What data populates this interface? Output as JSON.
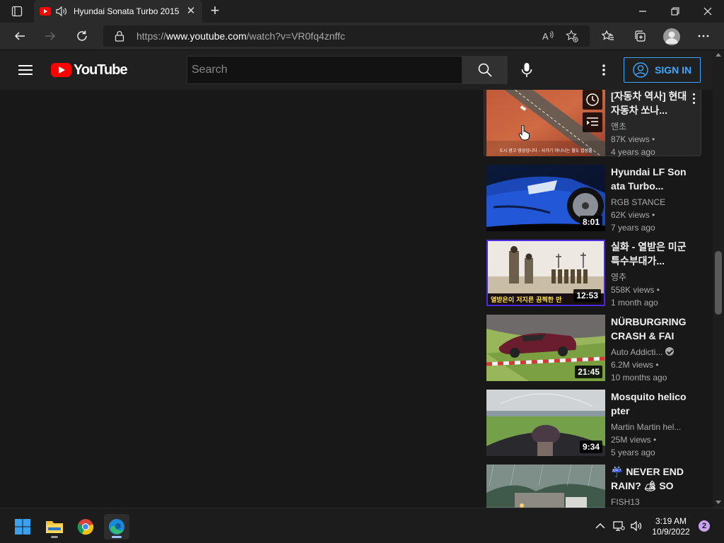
{
  "browser": {
    "tab_title": "Hyundai Sonata Turbo 2015",
    "tab_close": "✕",
    "new_tab": "+",
    "url_prefix": "https://",
    "url_domain": "www.youtube.com",
    "url_path": "/watch?v=VR0fq4znffc"
  },
  "youtube": {
    "logo_text": "YouTube",
    "search_placeholder": "Search",
    "signin_label": "SIGN IN"
  },
  "videos": [
    {
      "title": "[자동차 역사] 현대자동차 쏘나...",
      "channel": "앤초",
      "views": "87K views •",
      "age": "4 years ago",
      "duration": ""
    },
    {
      "title": "Hyundai LF Sonata Turbo...",
      "channel": "RGB STANCE",
      "views": "62K views •",
      "age": "7 years ago",
      "duration": "8:01"
    },
    {
      "title": "실화 - 열받은 미군 특수부대가...",
      "channel": "영추",
      "views": "558K views •",
      "age": "1 month ago",
      "duration": "12:53"
    },
    {
      "title": "NÜRBURGRING CRASH & FAIL...",
      "channel": "Auto Addicti...",
      "views": "6.2M views •",
      "age": "10 months ago",
      "duration": "21:45"
    },
    {
      "title": "Mosquito helicopter",
      "channel": "Martin Martin hel...",
      "views": "25M views •",
      "age": "5 years ago",
      "duration": "9:34"
    },
    {
      "title": "☔ NEVER END RAIN? 🏕 SOL...",
      "channel": "FISH13",
      "views": "",
      "age": "",
      "duration": ""
    }
  ],
  "thumb_overlay_text": "도시 광고 영상입니다 - 사가기 아니니는 월도 합성물",
  "thumb3_caption": "열받은이 저지른 끔찍한 만",
  "taskbar": {
    "time": "3:19 AM",
    "date": "10/9/2022",
    "notifications": "2"
  }
}
